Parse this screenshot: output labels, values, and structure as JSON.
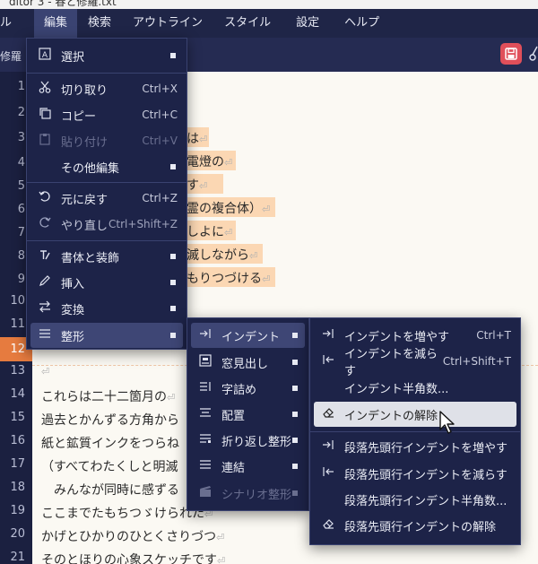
{
  "window": {
    "title": "ditor 3 - 春と修羅.txt"
  },
  "menubar": [
    {
      "id": "file",
      "label": "ル"
    },
    {
      "id": "edit",
      "label": "編集"
    },
    {
      "id": "search",
      "label": "検索"
    },
    {
      "id": "outline",
      "label": "アウトライン"
    },
    {
      "id": "style",
      "label": "スタイル"
    },
    {
      "id": "settings",
      "label": "設定"
    },
    {
      "id": "help",
      "label": "ヘルプ"
    }
  ],
  "toolbar": {
    "filename": "修羅"
  },
  "gutter": {
    "lines": [
      "1",
      "2",
      "3",
      "4",
      "5",
      "6",
      "7",
      "8",
      "9",
      "10",
      "11",
      "12",
      "13",
      "14",
      "15",
      "16",
      "17",
      "18",
      "19",
      "20",
      "21"
    ],
    "current": "12"
  },
  "editor": {
    "partial": [
      "は",
      "電燈の",
      "す",
      "霊の複合体）",
      "しよに",
      "滅しながら",
      "もりつづける"
    ],
    "lines": [
      "これらは二十二箇月の",
      "過去とかんずる方角から",
      "紙と鉱質インクをつらね",
      "（すべてわたくしと明滅",
      "　みんなが同時に感ずる",
      "ここまでたもちつゞけられた",
      "かげとひかりのひとくさりづつ",
      "そのとほりの心象スケッチです"
    ],
    "mark": "⏎",
    "mark13": "⏎"
  },
  "edit_menu": {
    "select": "選択",
    "cut": "切り取り",
    "cut_sc": "Ctrl+X",
    "copy": "コピー",
    "copy_sc": "Ctrl+C",
    "paste": "貼り付け",
    "paste_sc": "Ctrl+V",
    "other": "その他編集",
    "undo": "元に戻す",
    "undo_sc": "Ctrl+Z",
    "redo": "やり直し",
    "redo_sc": "Ctrl+Shift+Z",
    "font": "書体と装飾",
    "insert": "挿入",
    "convert": "変換",
    "format": "整形"
  },
  "format_menu": {
    "indent": "インデント",
    "window_heading": "窓見出し",
    "char_spacing": "字詰め",
    "align": "配置",
    "wrap_format": "折り返し整形",
    "concat": "連結",
    "scenario_format": "シナリオ整形"
  },
  "indent_menu": {
    "increase": "インデントを増やす",
    "increase_sc": "Ctrl+T",
    "decrease": "インデントを減らす",
    "decrease_sc": "Ctrl+Shift+T",
    "half_width": "インデント半角数...",
    "clear": "インデントの解除",
    "para_increase": "段落先頭行インデントを増やす",
    "para_decrease": "段落先頭行インデントを減らす",
    "para_half": "段落先頭行インデント半角数...",
    "para_clear": "段落先頭行インデントの解除"
  },
  "colors": {
    "accent": "#e67b3f",
    "save": "#e04f5a",
    "highlight": "#fbd7b3",
    "menu_bg": "#1d2348"
  }
}
